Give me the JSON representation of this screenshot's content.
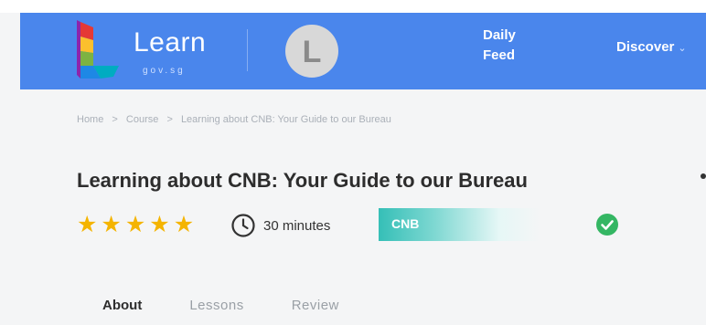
{
  "header": {
    "logo_text": "Learn",
    "logo_subtext": "gov.sg",
    "avatar_letter": "L",
    "nav": {
      "daily_feed_line1": "Daily",
      "daily_feed_line2": "Feed",
      "discover_label": "Discover",
      "discover_chevron": "⌄"
    }
  },
  "breadcrumb": {
    "items": [
      "Home",
      "Course",
      "Learning about CNB: Your Guide to our Bureau"
    ],
    "separator": ">"
  },
  "course": {
    "title": "Learning about CNB: Your Guide to our Bureau",
    "rating": 5,
    "rating_max": 5,
    "star_glyph": "★",
    "duration": "30 minutes",
    "tag": "CNB",
    "completed_icon": "check-circle-icon"
  },
  "tabs": [
    {
      "label": "About",
      "active": true
    },
    {
      "label": "Lessons",
      "active": false
    },
    {
      "label": "Review",
      "active": false
    }
  ],
  "colors": {
    "nav_background": "#4a86ec",
    "star": "#f4b400",
    "tag": "#35bfb7",
    "check": "#34b663"
  }
}
